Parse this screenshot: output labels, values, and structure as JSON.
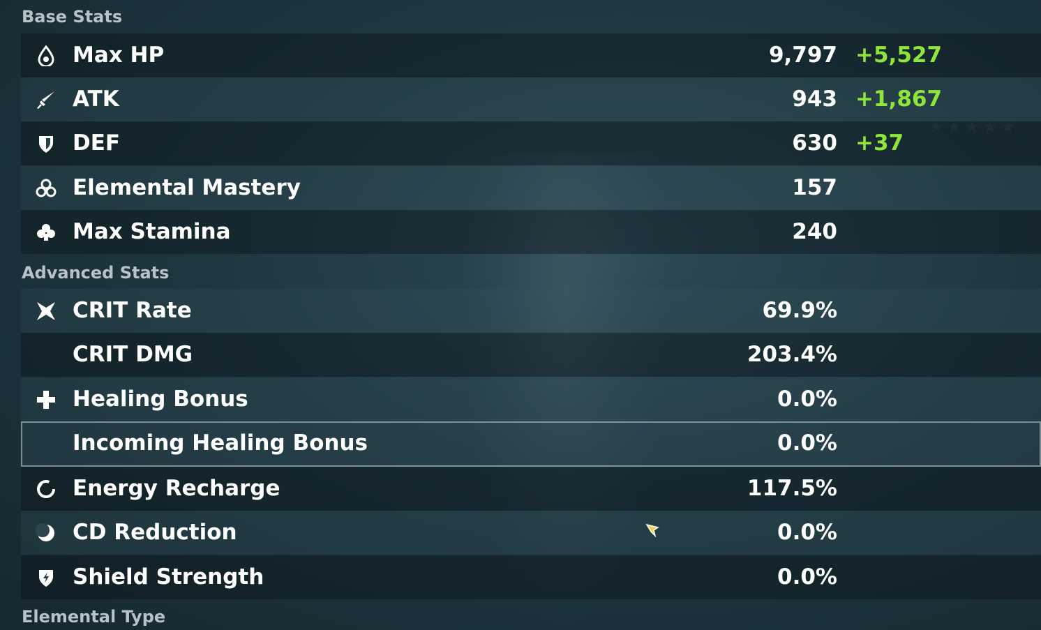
{
  "sections": {
    "base": "Base Stats",
    "advanced": "Advanced Stats",
    "elemental": "Elemental Type"
  },
  "base_stats": [
    {
      "label": "Max HP",
      "value": "9,797",
      "bonus": "+5,527",
      "icon": "hp-drop-icon"
    },
    {
      "label": "ATK",
      "value": "943",
      "bonus": "+1,867",
      "icon": "sword-icon"
    },
    {
      "label": "DEF",
      "value": "630",
      "bonus": "+37",
      "icon": "shield-icon"
    },
    {
      "label": "Elemental Mastery",
      "value": "157",
      "bonus": "",
      "icon": "mastery-icon"
    },
    {
      "label": "Max Stamina",
      "value": "240",
      "bonus": "",
      "icon": "stamina-icon"
    }
  ],
  "advanced_stats": [
    {
      "label": "CRIT Rate",
      "value": "69.9%",
      "icon": "crit-rate-icon"
    },
    {
      "label": "CRIT DMG",
      "value": "203.4%",
      "icon": ""
    },
    {
      "label": "Healing Bonus",
      "value": "0.0%",
      "icon": "healing-cross-icon"
    },
    {
      "label": "Incoming Healing Bonus",
      "value": "0.0%",
      "icon": ""
    },
    {
      "label": "Energy Recharge",
      "value": "117.5%",
      "icon": "energy-recharge-icon"
    },
    {
      "label": "CD Reduction",
      "value": "0.0%",
      "icon": "cd-reduction-icon"
    },
    {
      "label": "Shield Strength",
      "value": "0.0%",
      "icon": "shield-strength-icon"
    }
  ],
  "colors": {
    "bonus": "#8ee63b",
    "section_title": "#b8c3c8",
    "text": "#ffffff"
  }
}
